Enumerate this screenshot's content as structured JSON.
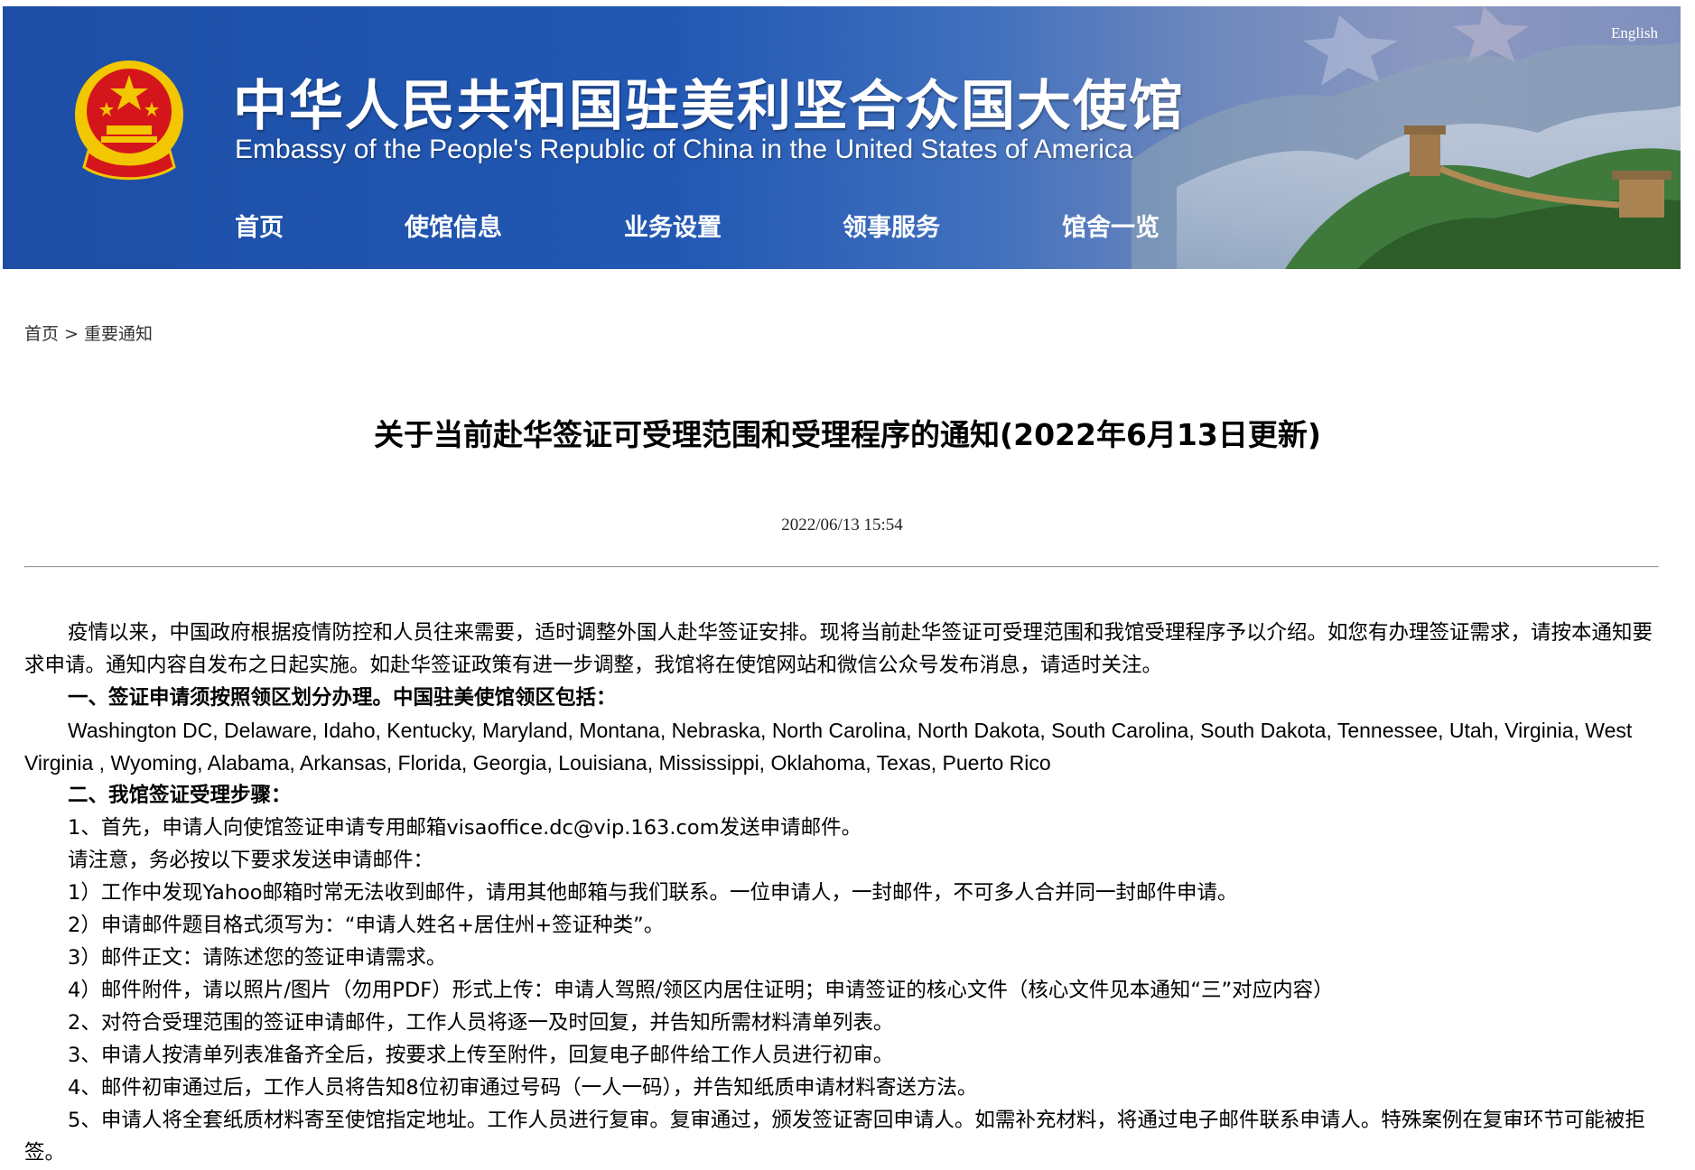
{
  "header": {
    "title_cn": "中华人民共和国驻美利坚合众国大使馆",
    "title_en": "Embassy of the People's Republic of China in the United States of America",
    "language_link": "English",
    "nav": [
      "首页",
      "使馆信息",
      "业务设置",
      "领事服务",
      "馆舍一览"
    ]
  },
  "breadcrumb": {
    "home": "首页",
    "separator": ">",
    "current": "重要通知"
  },
  "article": {
    "title": "关于当前赴华签证可受理范围和受理程序的通知(2022年6月13日更新)",
    "date": "2022/06/13 15:54",
    "paragraphs": [
      "疫情以来，中国政府根据疫情防控和人员往来需要，适时调整外国人赴华签证安排。现将当前赴华签证可受理范围和我馆受理程序予以介绍。如您有办理签证需求，请按本通知要求申请。通知内容自发布之日起实施。如赴华签证政策有进一步调整，我馆将在使馆网站和微信公众号发布消息，请适时关注。",
      "一、签证申请须按照领区划分办理。中国驻美使馆领区包括：",
      "Washington DC, Delaware, Idaho, Kentucky, Maryland, Montana, Nebraska, North Carolina, North Dakota,  South Carolina,  South Dakota, Tennessee, Utah, Virginia, West Virginia , Wyoming, Alabama, Arkansas, Florida, Georgia, Louisiana, Mississippi, Oklahoma, Texas, Puerto Rico",
      "二、我馆签证受理步骤：",
      "1、首先，申请人向使馆签证申请专用邮箱visaoffice.dc@vip.163.com发送申请邮件。",
      "请注意，务必按以下要求发送申请邮件：",
      "1）工作中发现Yahoo邮箱时常无法收到邮件，请用其他邮箱与我们联系。一位申请人，一封邮件，不可多人合并同一封邮件申请。",
      "2）申请邮件题目格式须写为：“申请人姓名+居住州+签证种类”。",
      "3）邮件正文：请陈述您的签证申请需求。",
      "4）邮件附件，请以照片/图片（勿用PDF）形式上传：申请人驾照/领区内居住证明；申请签证的核心文件（核心文件见本通知“三”对应内容）",
      "2、对符合受理范围的签证申请邮件，工作人员将逐一及时回复，并告知所需材料清单列表。",
      "3、申请人按清单列表准备齐全后，按要求上传至附件，回复电子邮件给工作人员进行初审。",
      "4、邮件初审通过后，工作人员将告知8位初审通过号码（一人一码），并告知纸质申请材料寄送方法。",
      "5、申请人将全套纸质材料寄至使馆指定地址。工作人员进行复审。复审通过，颁发签证寄回申请人。如需补充材料，将通过电子邮件联系申请人。特殊案例在复审环节可能被拒签。"
    ]
  },
  "colors": {
    "banner_blue": "#1d4ea5",
    "banner_right": "#8b98c0",
    "emblem_red": "#d4161c",
    "emblem_gold": "#f2c600",
    "divider": "#9a9a9a"
  },
  "icons": [
    "national-emblem",
    "great-wall-landscape"
  ]
}
